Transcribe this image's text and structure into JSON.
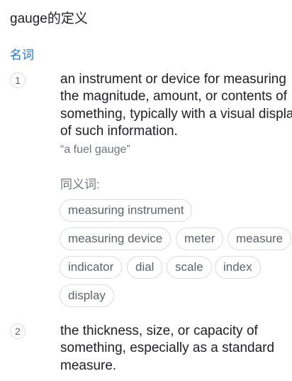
{
  "header": {
    "title": "gauge的定义",
    "part_of_speech": "名词"
  },
  "senses": [
    {
      "number": "1",
      "definition": "an instrument or device for measuring the magnitude, amount, or contents of something, typically with a visual display of such information.",
      "example": "“a fuel gauge”",
      "synonyms_label": "同义词:",
      "synonyms": [
        "measuring instrument",
        "measuring device",
        "meter",
        "measure",
        "indicator",
        "dial",
        "scale",
        "index",
        "display"
      ]
    },
    {
      "number": "2",
      "definition": "the thickness, size, or capacity of something, especially as a standard measure."
    }
  ]
}
